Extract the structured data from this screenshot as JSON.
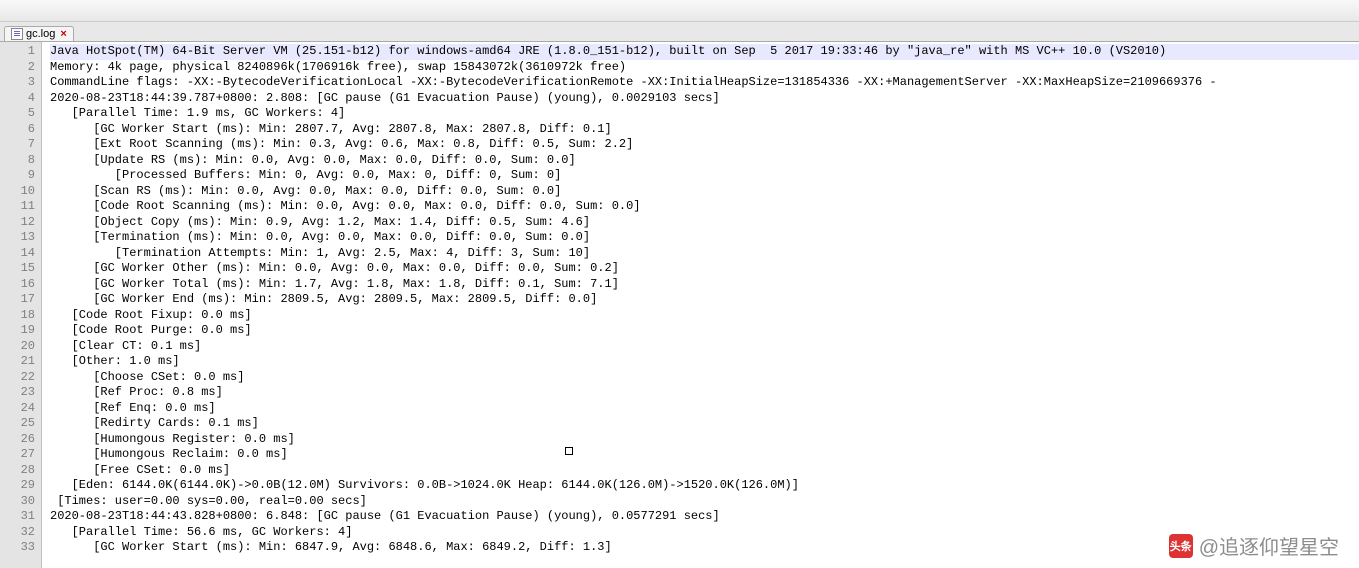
{
  "tab": {
    "filename": "gc.log",
    "close": "×"
  },
  "lines": [
    "Java HotSpot(TM) 64-Bit Server VM (25.151-b12) for windows-amd64 JRE (1.8.0_151-b12), built on Sep  5 2017 19:33:46 by \"java_re\" with MS VC++ 10.0 (VS2010)",
    "Memory: 4k page, physical 8240896k(1706916k free), swap 15843072k(3610972k free)",
    "CommandLine flags: -XX:-BytecodeVerificationLocal -XX:-BytecodeVerificationRemote -XX:InitialHeapSize=131854336 -XX:+ManagementServer -XX:MaxHeapSize=2109669376 -",
    "2020-08-23T18:44:39.787+0800: 2.808: [GC pause (G1 Evacuation Pause) (young), 0.0029103 secs]",
    "   [Parallel Time: 1.9 ms, GC Workers: 4]",
    "      [GC Worker Start (ms): Min: 2807.7, Avg: 2807.8, Max: 2807.8, Diff: 0.1]",
    "      [Ext Root Scanning (ms): Min: 0.3, Avg: 0.6, Max: 0.8, Diff: 0.5, Sum: 2.2]",
    "      [Update RS (ms): Min: 0.0, Avg: 0.0, Max: 0.0, Diff: 0.0, Sum: 0.0]",
    "         [Processed Buffers: Min: 0, Avg: 0.0, Max: 0, Diff: 0, Sum: 0]",
    "      [Scan RS (ms): Min: 0.0, Avg: 0.0, Max: 0.0, Diff: 0.0, Sum: 0.0]",
    "      [Code Root Scanning (ms): Min: 0.0, Avg: 0.0, Max: 0.0, Diff: 0.0, Sum: 0.0]",
    "      [Object Copy (ms): Min: 0.9, Avg: 1.2, Max: 1.4, Diff: 0.5, Sum: 4.6]",
    "      [Termination (ms): Min: 0.0, Avg: 0.0, Max: 0.0, Diff: 0.0, Sum: 0.0]",
    "         [Termination Attempts: Min: 1, Avg: 2.5, Max: 4, Diff: 3, Sum: 10]",
    "      [GC Worker Other (ms): Min: 0.0, Avg: 0.0, Max: 0.0, Diff: 0.0, Sum: 0.2]",
    "      [GC Worker Total (ms): Min: 1.7, Avg: 1.8, Max: 1.8, Diff: 0.1, Sum: 7.1]",
    "      [GC Worker End (ms): Min: 2809.5, Avg: 2809.5, Max: 2809.5, Diff: 0.0]",
    "   [Code Root Fixup: 0.0 ms]",
    "   [Code Root Purge: 0.0 ms]",
    "   [Clear CT: 0.1 ms]",
    "   [Other: 1.0 ms]",
    "      [Choose CSet: 0.0 ms]",
    "      [Ref Proc: 0.8 ms]",
    "      [Ref Enq: 0.0 ms]",
    "      [Redirty Cards: 0.1 ms]",
    "      [Humongous Register: 0.0 ms]",
    "      [Humongous Reclaim: 0.0 ms]",
    "      [Free CSet: 0.0 ms]",
    "   [Eden: 6144.0K(6144.0K)->0.0B(12.0M) Survivors: 0.0B->1024.0K Heap: 6144.0K(126.0M)->1520.0K(126.0M)]",
    " [Times: user=0.00 sys=0.00, real=0.00 secs] ",
    "2020-08-23T18:44:43.828+0800: 6.848: [GC pause (G1 Evacuation Pause) (young), 0.0577291 secs]",
    "   [Parallel Time: 56.6 ms, GC Workers: 4]",
    "      [GC Worker Start (ms): Min: 6847.9, Avg: 6848.6, Max: 6849.2, Diff: 1.3]"
  ],
  "watermark": {
    "icon": "头条",
    "text": "@追逐仰望星空"
  }
}
